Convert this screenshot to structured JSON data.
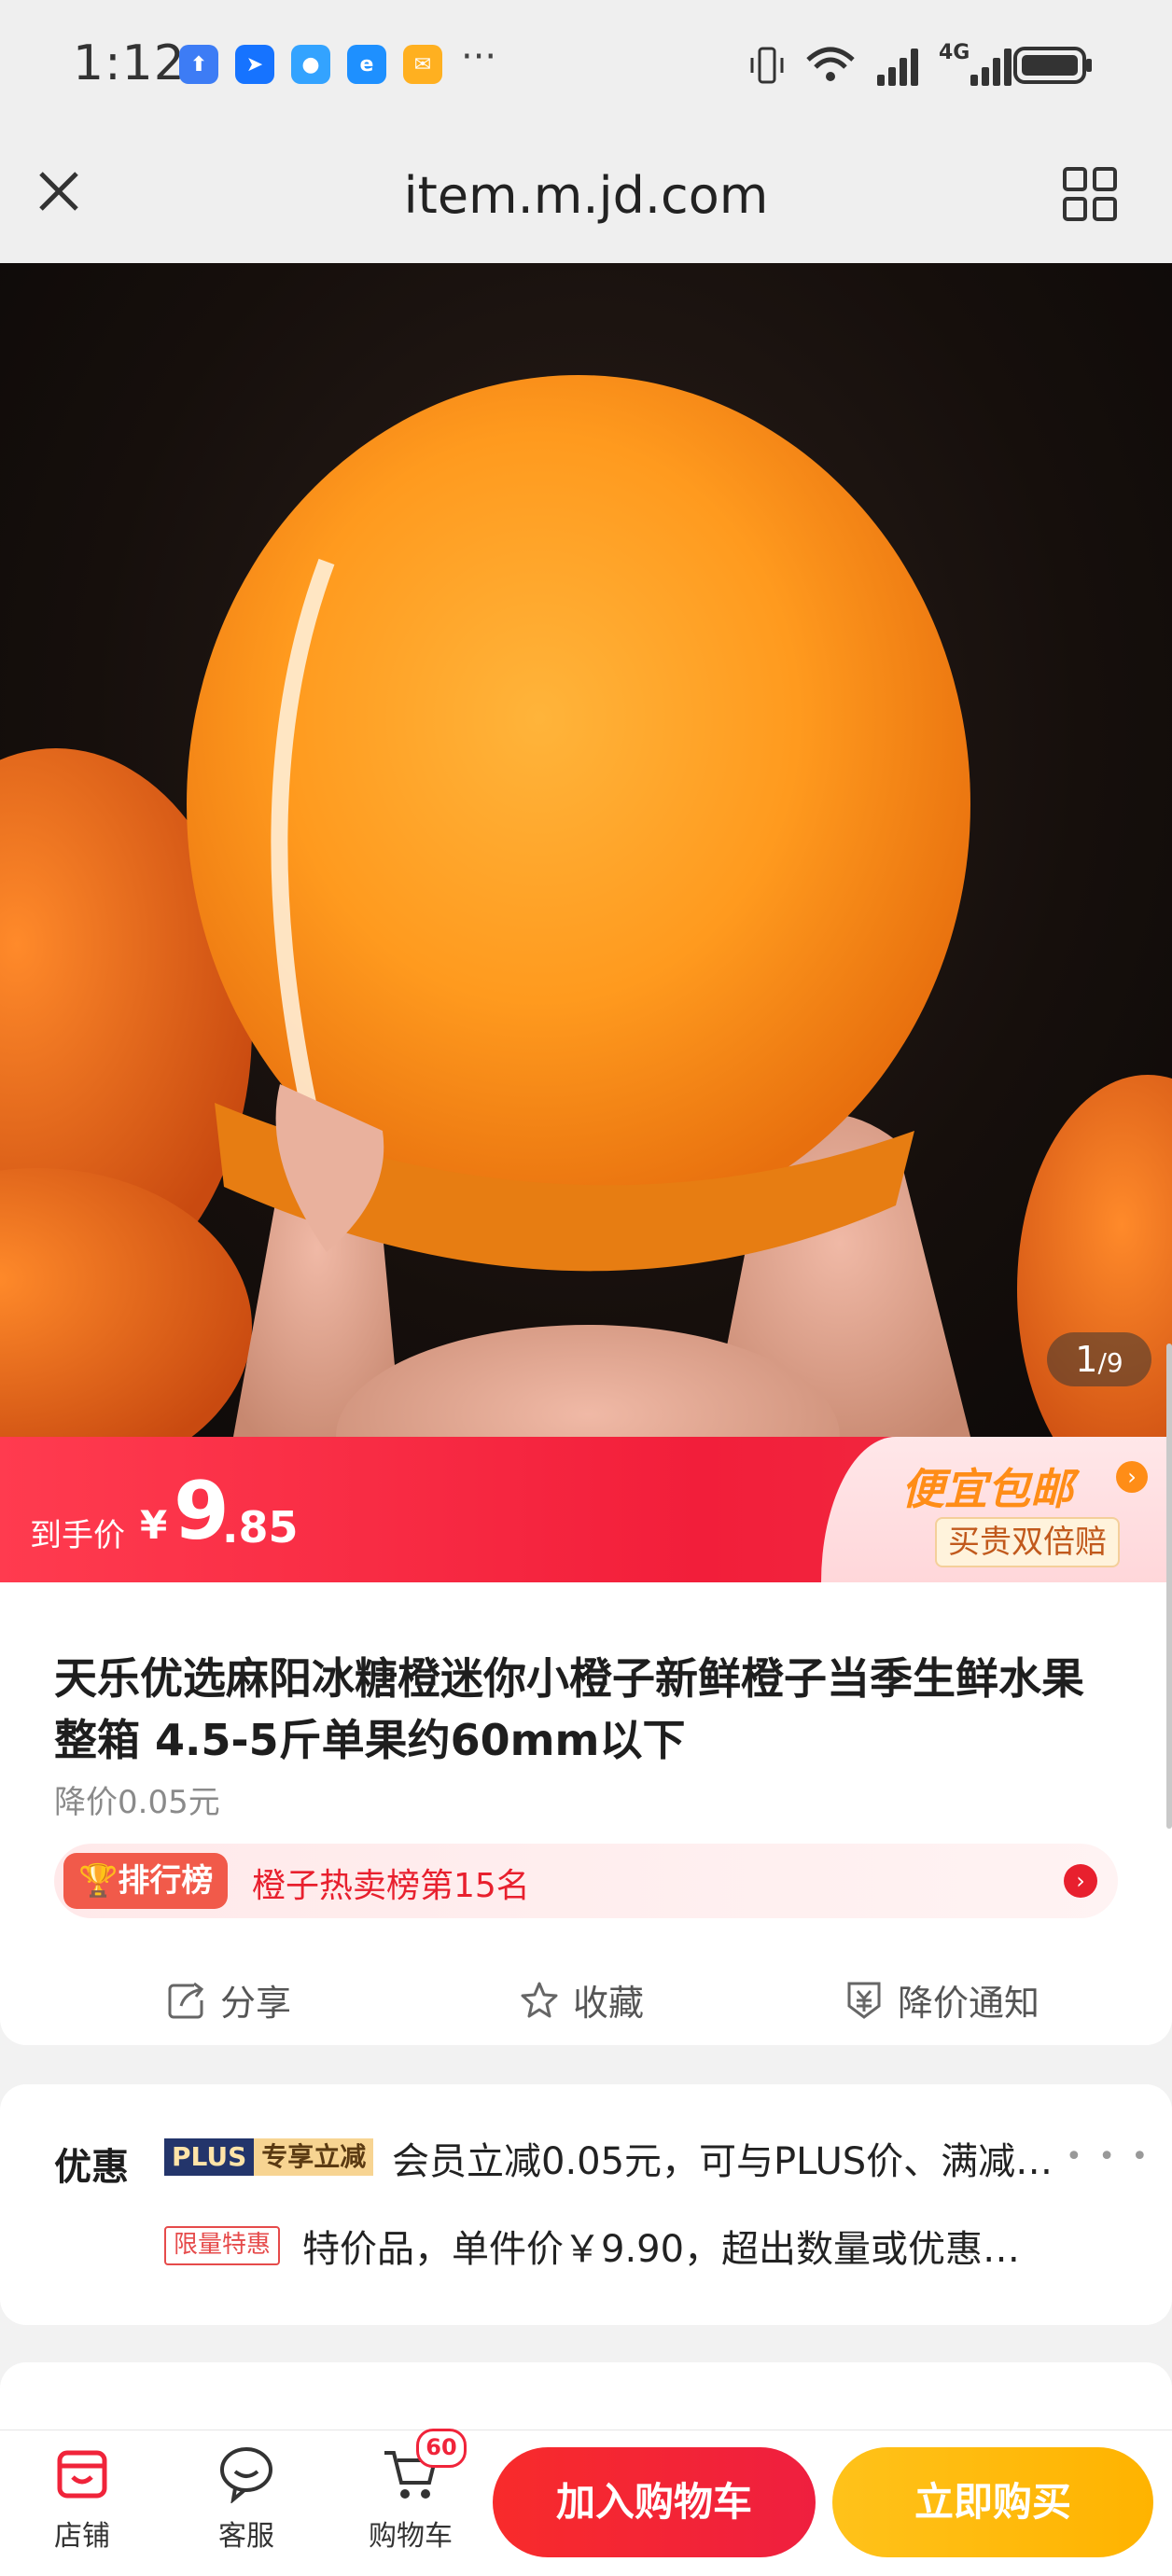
{
  "status_bar": {
    "time": "1:12",
    "more": "···",
    "network": "4G",
    "icons": [
      "upload-app-icon",
      "arrow-app-icon",
      "chat-app-icon",
      "browser-app-icon",
      "mail-app-icon",
      "vibrate-icon",
      "wifi-icon",
      "signal-icon",
      "battery-icon"
    ]
  },
  "browser": {
    "url": "item.m.jd.com",
    "close_icon": "close-icon",
    "menu_icon": "grid-icon"
  },
  "gallery": {
    "current": "1",
    "total": "/9"
  },
  "price_banner": {
    "label": "到手价",
    "currency": "¥",
    "integer": "9",
    "decimal": ".85",
    "promo": "便宜包邮",
    "guarantee": "买贵双倍赔",
    "colors": {
      "red": "#f21e3a",
      "promo": "#ff8d17"
    }
  },
  "product": {
    "title": "天乐优选麻阳冰糖橙迷你小橙子新鲜橙子当季生鲜水果整箱 4.5-5斤单果约60mm以下",
    "price_drop": "降价0.05元",
    "rank_badge": "排行榜",
    "rank_text": "橙子热卖榜第15名",
    "actions": [
      {
        "label": "分享",
        "icon": "share-icon"
      },
      {
        "label": "收藏",
        "icon": "star-icon"
      },
      {
        "label": "降价通知",
        "icon": "price-alert-icon"
      }
    ]
  },
  "discounts": {
    "heading": "优惠",
    "plus_tag": "PLUS",
    "plus_sub": "专享立减",
    "line1": "会员立减0.05元，可与PLUS价、满减…",
    "limited_tag": "限量特惠",
    "line2": "特价品，单件价￥9.90，超出数量或优惠…",
    "dots": "• • •"
  },
  "bottom_bar": {
    "shop": "店铺",
    "service": "客服",
    "cart": "购物车",
    "cart_count": "60",
    "add_to_cart": "加入购物车",
    "buy_now": "立即购买"
  }
}
